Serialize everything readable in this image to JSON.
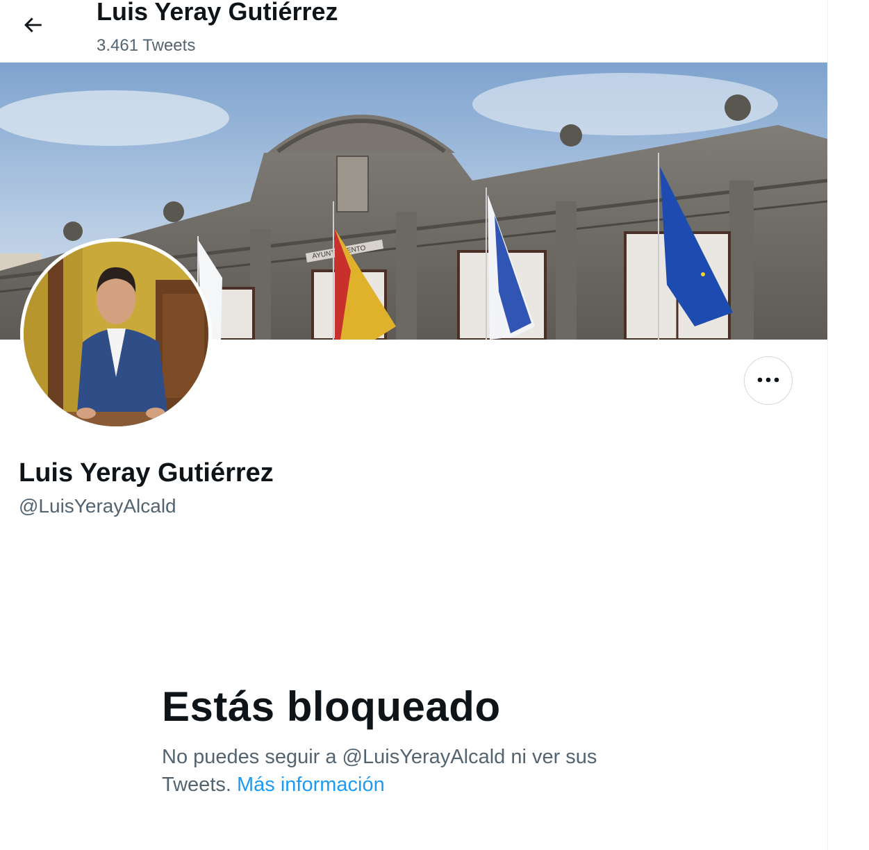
{
  "header": {
    "title": "Luis Yeray Gutiérrez",
    "tweet_count": "3.461 Tweets"
  },
  "banner": {
    "plaque_text": "AYUNTAMIENTO"
  },
  "profile": {
    "name": "Luis Yeray Gutiérrez",
    "handle": "@LuisYerayAlcald"
  },
  "blocked": {
    "title": "Estás bloqueado",
    "message_prefix": "No puedes seguir a @LuisYerayAlcald ni ver sus Tweets. ",
    "learn_more": "Más información"
  },
  "icons": {
    "back": "arrow-left-icon",
    "more": "more-horizontal-icon"
  },
  "colors": {
    "link": "#1d9bf0",
    "secondary_text": "#536471",
    "primary_text": "#0f1419"
  }
}
